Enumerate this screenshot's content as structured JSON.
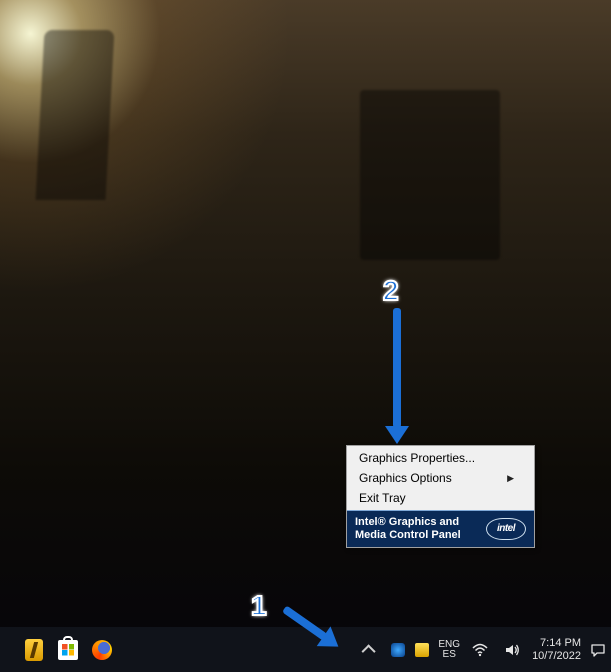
{
  "context_menu": {
    "items": [
      {
        "label": "Graphics Properties...",
        "has_submenu": false
      },
      {
        "label": "Graphics Options",
        "has_submenu": true
      },
      {
        "label": "Exit Tray",
        "has_submenu": false
      }
    ],
    "footer": {
      "title": "Intel® Graphics and Media Control Panel",
      "logo_text": "intel"
    }
  },
  "annotations": {
    "step1": "1",
    "step2": "2"
  },
  "taskbar": {
    "language": {
      "line1": "ENG",
      "line2": "ES"
    },
    "clock": {
      "time": "7:14 PM",
      "date": "10/7/2022"
    }
  }
}
